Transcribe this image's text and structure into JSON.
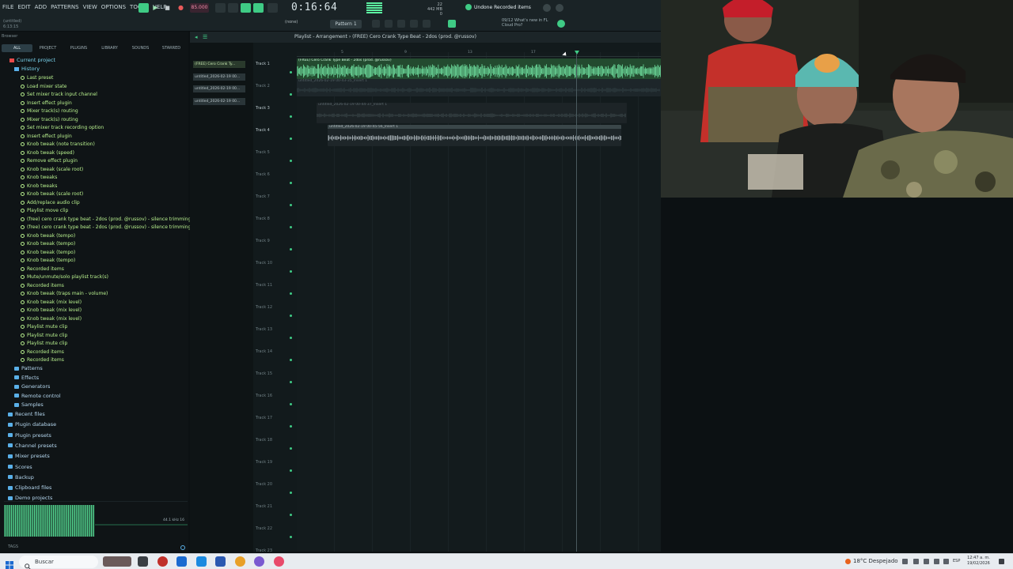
{
  "menu": [
    "FILE",
    "EDIT",
    "ADD",
    "PATTERNS",
    "VIEW",
    "OPTIONS",
    "TOOLS",
    "HELP"
  ],
  "hint_area": {
    "line1": "(untitled)",
    "line2": "6:13:15"
  },
  "tempo": "85.000",
  "time": "0:16:64",
  "cpu": {
    "line1": "22",
    "line2": "442 MB",
    "line3": "0"
  },
  "hint_bar": "Undone Recorded items",
  "news": {
    "line1": "09/12 What's new in FL",
    "line2": "Cloud Pro?"
  },
  "pattern": "Pattern 1",
  "snap": "(none)",
  "browser": {
    "title": "Browser",
    "tabs": [
      "ALL",
      "PROJECT",
      "PLUGINS",
      "LIBRARY",
      "SOUNDS",
      "STARRED"
    ],
    "current_project": "Current project",
    "history": "History",
    "history_items": [
      "Last preset",
      "Load mixer state",
      "Set mixer track input channel",
      "Insert effect plugin",
      "Mixer track(s) routing",
      "Mixer track(s) routing",
      "Set mixer track recording option",
      "Insert effect plugin",
      "Knob tweak (note transition)",
      "Knob tweak (speed)",
      "Remove effect plugin",
      "Knob tweak (scale root)",
      "Knob tweaks",
      "Knob tweaks",
      "Knob tweak (scale root)",
      "Add/replace audio clip",
      "Playlist move clip",
      "(free) cero crank type beat - 2dos (prod. @russov) - silence trimming threshold",
      "(free) cero crank type beat - 2dos (prod. @russov) - silence trimming threshold",
      "Knob tweak (tempo)",
      "Knob tweak (tempo)",
      "Knob tweak (tempo)",
      "Knob tweak (tempo)",
      "Recorded items",
      "Mute/unmute/solo playlist track(s)",
      "Recorded items",
      "Knob tweak (traps main - volume)",
      "Knob tweak (mix level)",
      "Knob tweak (mix level)",
      "Knob tweak (mix level)",
      "Playlist mute clip",
      "Playlist mute clip",
      "Playlist mute clip",
      "Recorded items",
      "Recorded items"
    ],
    "project_folders": [
      "Patterns",
      "Effects",
      "Generators",
      "Remote control",
      "Samples"
    ],
    "folders": [
      "Recent files",
      "Plugin database",
      "Plugin presets",
      "Channel presets",
      "Mixer presets",
      "Scores",
      "Backup",
      "Clipboard files",
      "Demo projects"
    ],
    "wave_info": "44.1 kHz 16",
    "tags": "TAGS"
  },
  "playlist": {
    "title": "Playlist - Arrangement › (FREE) Cero Crank Type Beat - 2dos (prod. @russov)",
    "picker_clips": [
      "(FREE) Cero Crank Ty...",
      "untitled_2026-02-19 00...",
      "untitled_2026-02-19 00...",
      "untitled_2026-02-19 00..."
    ],
    "tracks": [
      "Track 1",
      "Track 2",
      "Track 3",
      "Track 4",
      "Track 5",
      "Track 6",
      "Track 7",
      "Track 8",
      "Track 9",
      "Track 10",
      "Track 11",
      "Track 12",
      "Track 13",
      "Track 14",
      "Track 15",
      "Track 16",
      "Track 17",
      "Track 18",
      "Track 19",
      "Track 20",
      "Track 21",
      "Track 22",
      "Track 23"
    ],
    "timeline": [
      "5",
      "9",
      "13",
      "17"
    ],
    "clips": {
      "clip1": "(FREE) Cero Crank Type Beat - 2dos (prod. @russov)",
      "clip2": "untitled_2026-02-19 00-43-35_Insert 1",
      "clip3": "untitled_2026-02-19 00-44-37_Insert 1",
      "clip4": "untitled_2026-02-19 00-45-56_Insert 1"
    }
  },
  "taskbar": {
    "search": "Buscar",
    "weather": "18°C Despejado",
    "lang": "ESP",
    "time": "12:47 a. m.",
    "date": "19/02/2026"
  },
  "colors": {
    "accent": "#3fcb85",
    "history_text": "#b8f08e",
    "folder_text": "#b6d8f0"
  }
}
